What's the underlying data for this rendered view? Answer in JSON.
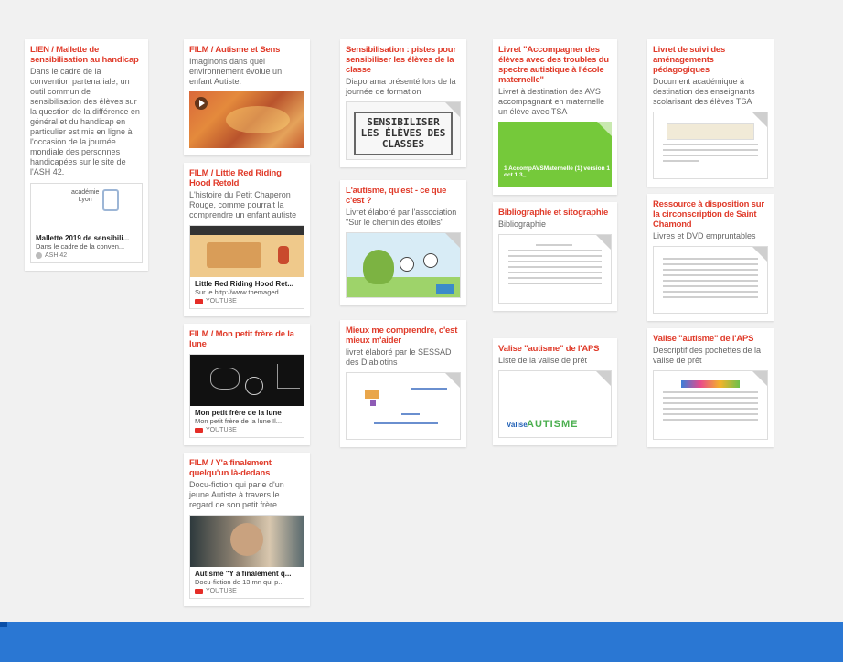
{
  "cards": {
    "c1": {
      "title": "LIEN / Mallette de sensibilisation au handicap",
      "desc": "Dans le cadre de la convention partenariale, un outil commun de sensibilisation des élèves sur la question de la différence en général et du handicap en particulier est mis en ligne à l'occasion de la journée mondiale des personnes handicapées sur le site de l'ASH 42.",
      "logo_lines": [
        "académie",
        "Lyon"
      ],
      "embed_title": "Mallette 2019 de sensibili...",
      "embed_sub": "Dans le cadre de la conven...",
      "embed_src": "ASH 42"
    },
    "c2": {
      "title": "FILM / Autisme et Sens",
      "desc": "Imaginons dans quel environnement évolue un enfant Autiste."
    },
    "c3": {
      "title": "FILM / Little Red Riding Hood Retold",
      "desc": "L'histoire du Petit Chaperon Rouge, comme pourrait la comprendre un enfant autiste",
      "embed_title": "Little Red Riding Hood Ret...",
      "embed_sub": "Sur le http://www.themaged...",
      "embed_src": "YOUTUBE"
    },
    "c4": {
      "title": "FILM / Mon petit frère de la lune",
      "embed_title": "Mon petit frère de la lune",
      "embed_sub": "Mon petit frère de la lune Il...",
      "embed_src": "YOUTUBE"
    },
    "c5": {
      "title": "FILM / Y'a finalement quelqu'un là-dedans",
      "desc": "Docu-fiction qui parle d'un jeune Autiste à travers le regard de son petit frère",
      "embed_title": "Autisme \"Y a finalement q...",
      "embed_sub": "Docu-fiction de 13 mn qui p...",
      "embed_src": "YOUTUBE"
    },
    "c6": {
      "title": "Sensibilisation : pistes pour sensibiliser les élèves de la classe",
      "desc": "Diaporama présenté lors de la journée de formation",
      "banner": "SENSIBILISER LES ÉLÈVES DES CLASSES"
    },
    "c7": {
      "title": "L'autisme, qu'est - ce que c'est ?",
      "desc": "Livret élaboré par l'association \"Sur le chemin des étoiles\""
    },
    "c8": {
      "title": "Mieux me comprendre, c'est mieux m'aider",
      "desc": "livret élaboré par le SESSAD des Diablotins"
    },
    "c9": {
      "title": "Livret \"Accompagner des élèves avec des troubles du spectre autistique à l'école maternelle\"",
      "desc": "Livret à destination des AVS accompagnant en maternelle un élève avec TSA",
      "green_cap": "1 AccompAVSMaternelle (1) version 1 oct 1 3_..."
    },
    "c10": {
      "title": "Bibliographie et sitographie",
      "desc": "Bibliographie"
    },
    "c11": {
      "title": "Valise \"autisme\" de l'APS",
      "desc": "Liste de la valise de prêt",
      "autism_pre": "Valise",
      "autism_word": "AUTISME"
    },
    "c12": {
      "title": "Livret de suivi des aménagements pédagogiques",
      "desc": "Document académique à destination des enseignants scolarisant des élèves TSA"
    },
    "c13": {
      "title": "Ressource à disposition sur la circonscription de Saint Chamond",
      "desc": "Livres et DVD empruntables"
    },
    "c14": {
      "title": "Valise \"autisme\" de l'APS",
      "desc": "Descriptif des pochettes de la valise de prêt"
    }
  },
  "colors": {
    "title_red": "#e03b2a",
    "bottom_bar": "#2a77d3",
    "board_bg": "#f1f1f1"
  }
}
